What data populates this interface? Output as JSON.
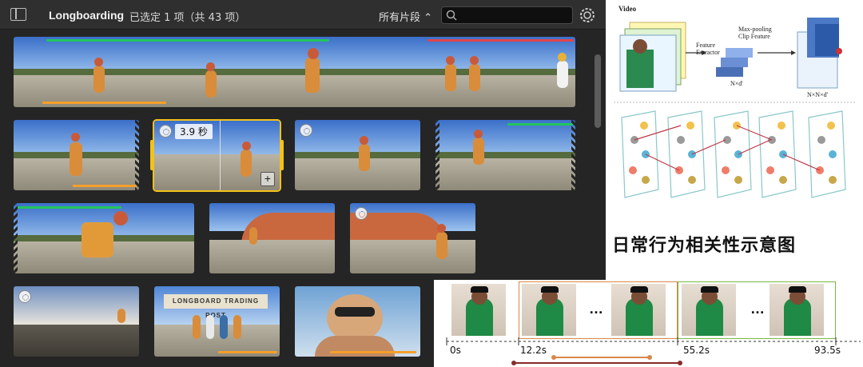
{
  "toolbar": {
    "library_title": "Longboarding",
    "selection_info": "已选定 1 项（共 43 项）",
    "filter_label": "所有片段",
    "search_placeholder": ""
  },
  "clips": {
    "selected_duration": "3.9 秒",
    "add_symbol": "+"
  },
  "billboard_text": "LONGBOARD TRADING POST",
  "diagram": {
    "video_label": "Video",
    "feature_extractor": "Feature\nExtractor",
    "max_pooling": "Max-pooling\nClip Feature",
    "n_d": "N×d'",
    "n_n_d": "N×N×d'"
  },
  "heading": "日常行为相关性示意图",
  "timeline": {
    "t0": "0s",
    "t1": "12.2s",
    "t2": "55.2s",
    "t3": "93.5s",
    "ellipsis": "…"
  },
  "colors": {
    "selection": "#f3c21a",
    "green_bar": "#22c55e",
    "red_bar": "#e3434a",
    "orange_bar": "#f59f2a",
    "timeline_orange": "#d9874a",
    "timeline_green": "#7ab648"
  }
}
